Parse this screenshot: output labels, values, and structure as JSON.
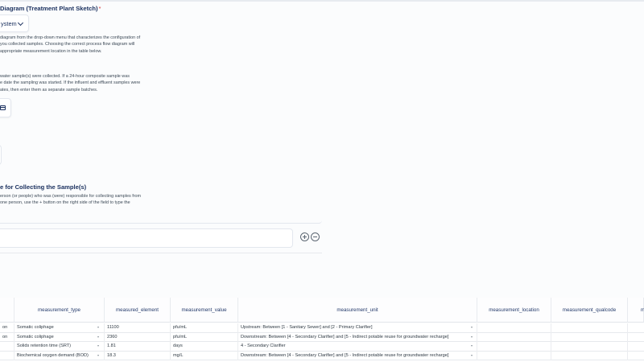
{
  "diagram_section": {
    "title": "Diagram (Treatment Plant Sketch)",
    "required_mark": "*",
    "dropdown_value": "ystem",
    "help_lines": [
      "diagram from the drop-down menu that characterizes the configuration of",
      "you collected samples. Choosing the correct process flow diagram will",
      "appropriate measurement location in the table below."
    ]
  },
  "date_section": {
    "help_lines": [
      "water sample(s) were collected. If a 24-hour composite sample was",
      "e date the sampling was started. If the influent and effluent samples were",
      "ates, then enter them as separate sample batches."
    ]
  },
  "collector_section": {
    "title": "e for Collecting the Sample(s)",
    "help_lines": [
      "erson (or people) who was (were) responsible for collecting samples from",
      "one person, use the + button on the right side of the field to type the"
    ]
  },
  "table": {
    "columns": [
      "measurement_type",
      "measured_element",
      "measurement_value",
      "measurement_unit",
      "measurement_location",
      "measurement_qualcode",
      "m"
    ],
    "rows": [
      {
        "prefix": "on",
        "type": "Somatic coliphage",
        "element": "11100",
        "value": "pfu/mL",
        "unit": "Upstream: Between [1 - Sanitary Sewer] and [2 - Primary Clarifier]"
      },
      {
        "prefix": "on",
        "type": "Somatic coliphage",
        "element": "2360",
        "value": "pfu/mL",
        "unit": "Downstream: Between [4 - Secondary Clarifier] and [5 - Indirect potable reuse for groundwater recharge]"
      },
      {
        "prefix": "",
        "type": "Solids retention time (SRT)",
        "element": "1.81",
        "value": "days",
        "unit": "4 - Secondary Clarifier"
      },
      {
        "prefix": "",
        "type": "Biochemical oxygen demand (BOD)",
        "element": "18.3",
        "value": "mg/L",
        "unit": "Downstream: Between [4 - Secondary Clarifier] and [5 - Indirect potable reuse for groundwater recharge]"
      }
    ]
  }
}
